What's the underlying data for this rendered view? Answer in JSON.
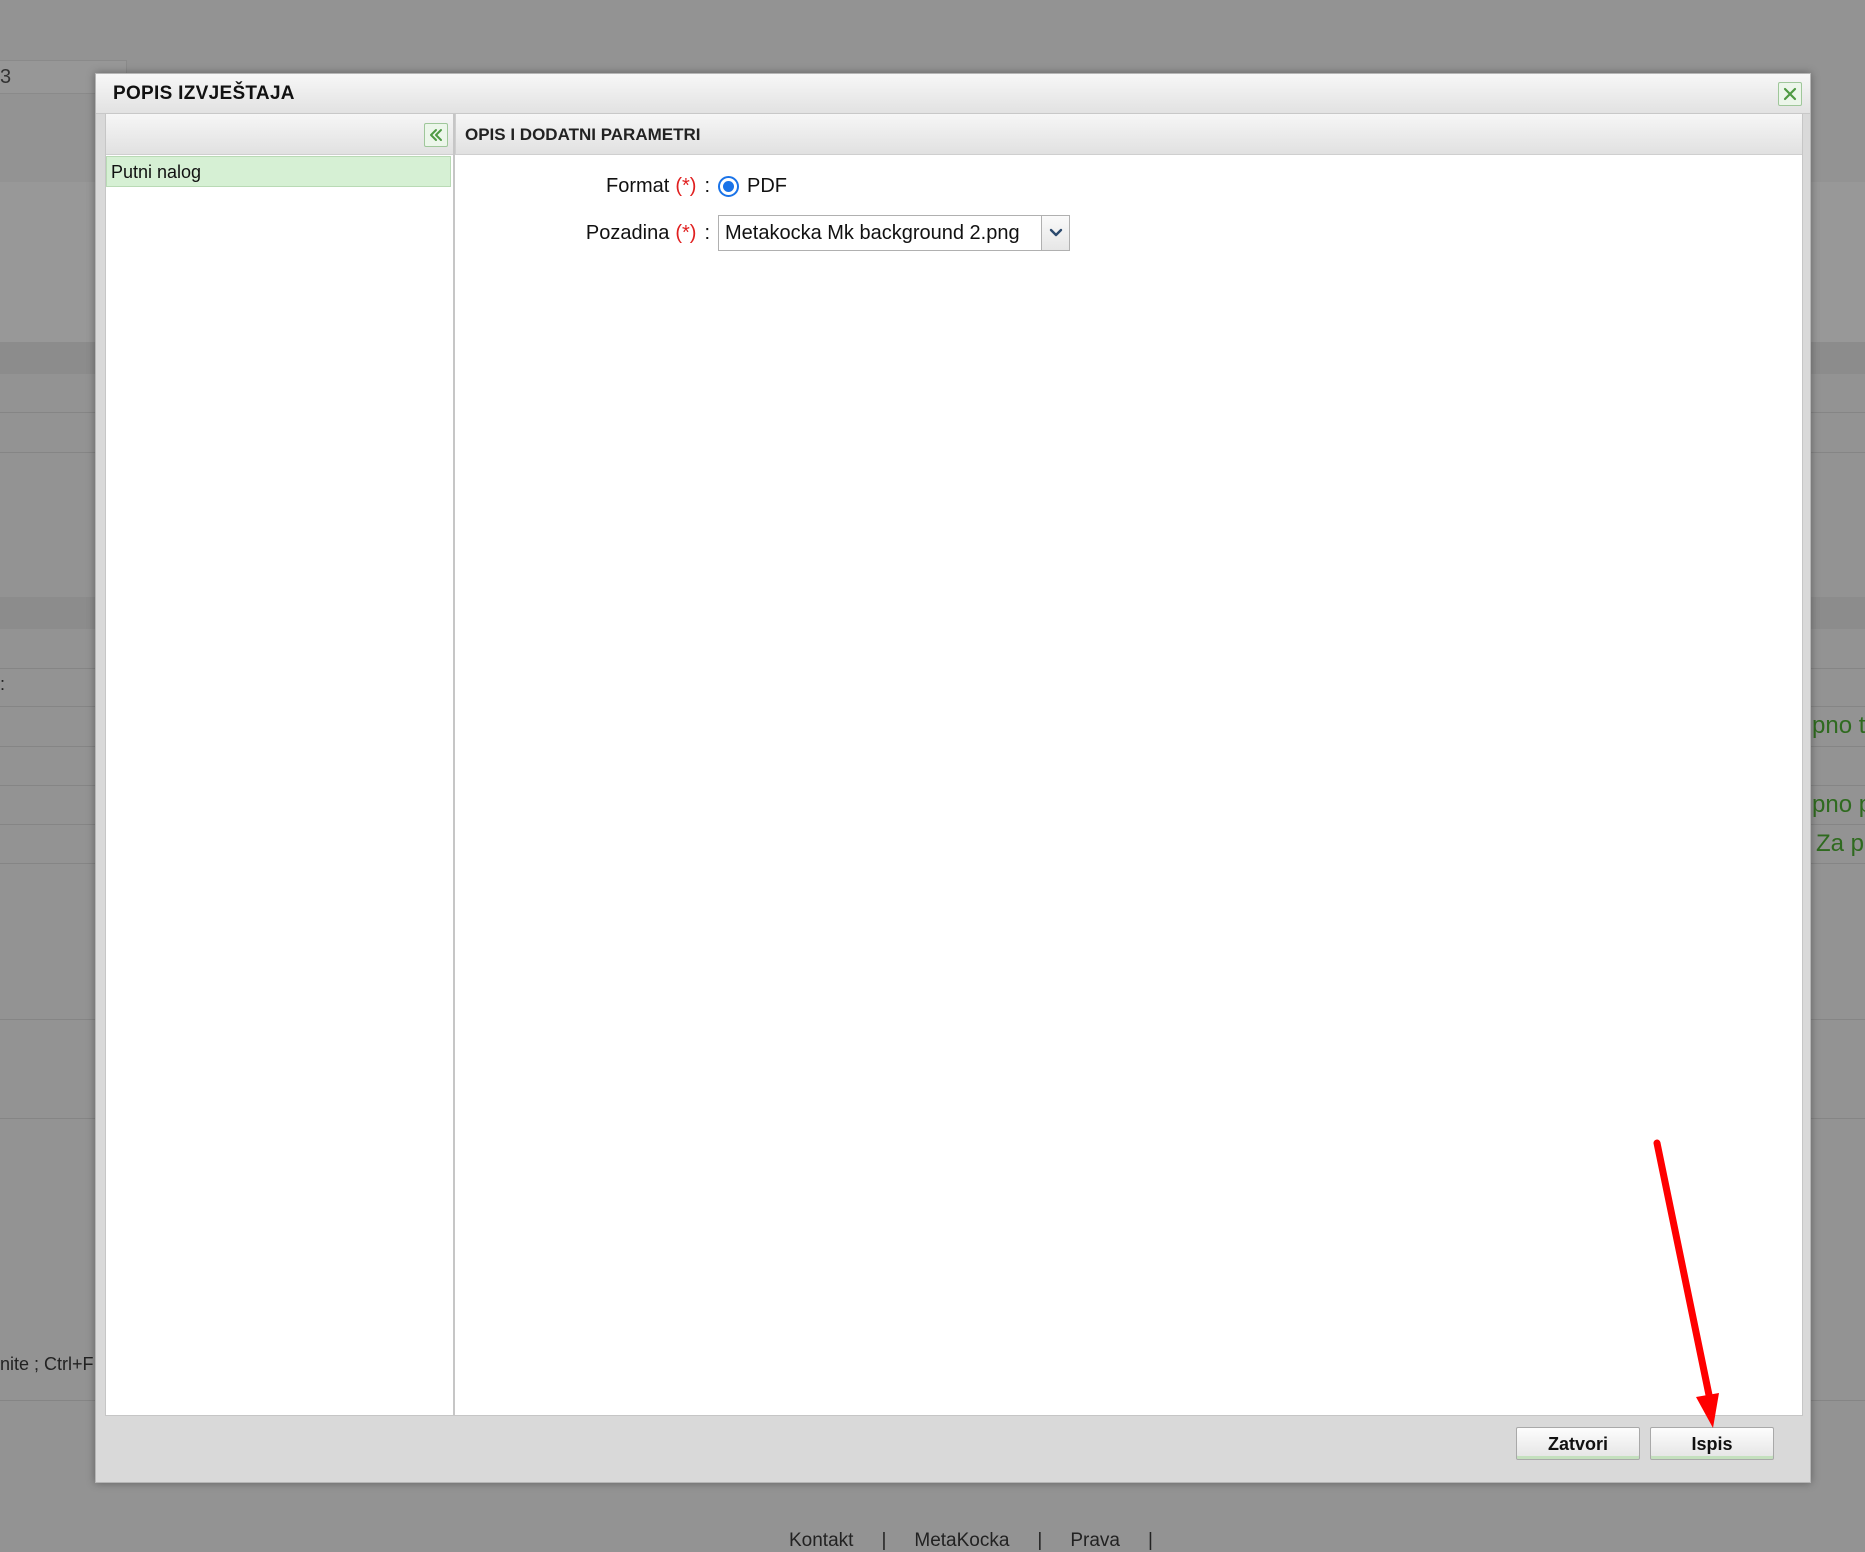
{
  "background": {
    "top_field_text": "3",
    "right_snippets": [
      "pno t",
      "pno p",
      "Za p"
    ],
    "left_snippet_shortcut": "nite ;  Ctrl+F",
    "left_colon": ":",
    "footer_links": [
      "Kontakt",
      "|",
      "MetaKocka",
      "|",
      "Prava",
      "|"
    ]
  },
  "modal": {
    "title": "POPIS IZVJEŠTAJA",
    "close_icon": "close-icon",
    "left_panel": {
      "collapse_icon": "double-chevron-left-icon",
      "reports": [
        {
          "label": "Putni nalog",
          "selected": true
        }
      ]
    },
    "right_panel": {
      "header": "OPIS I DODATNI PARAMETRI",
      "format": {
        "label": "Format",
        "required_marker": "(*)",
        "colon": ":",
        "option": "PDF",
        "selected": true
      },
      "background_field": {
        "label": "Pozadina",
        "required_marker": "(*)",
        "colon": ":",
        "value": "Metakocka Mk background 2.png",
        "arrow_icon": "chevron-down-icon"
      }
    },
    "buttons": {
      "close": "Zatvori",
      "print": "Ispis"
    }
  },
  "colors": {
    "overlay": "#939393",
    "accent_green": "#6aa84f",
    "required_red": "#e02020",
    "radio_blue": "#1a73e8",
    "annotation_arrow": "#ff0000"
  }
}
